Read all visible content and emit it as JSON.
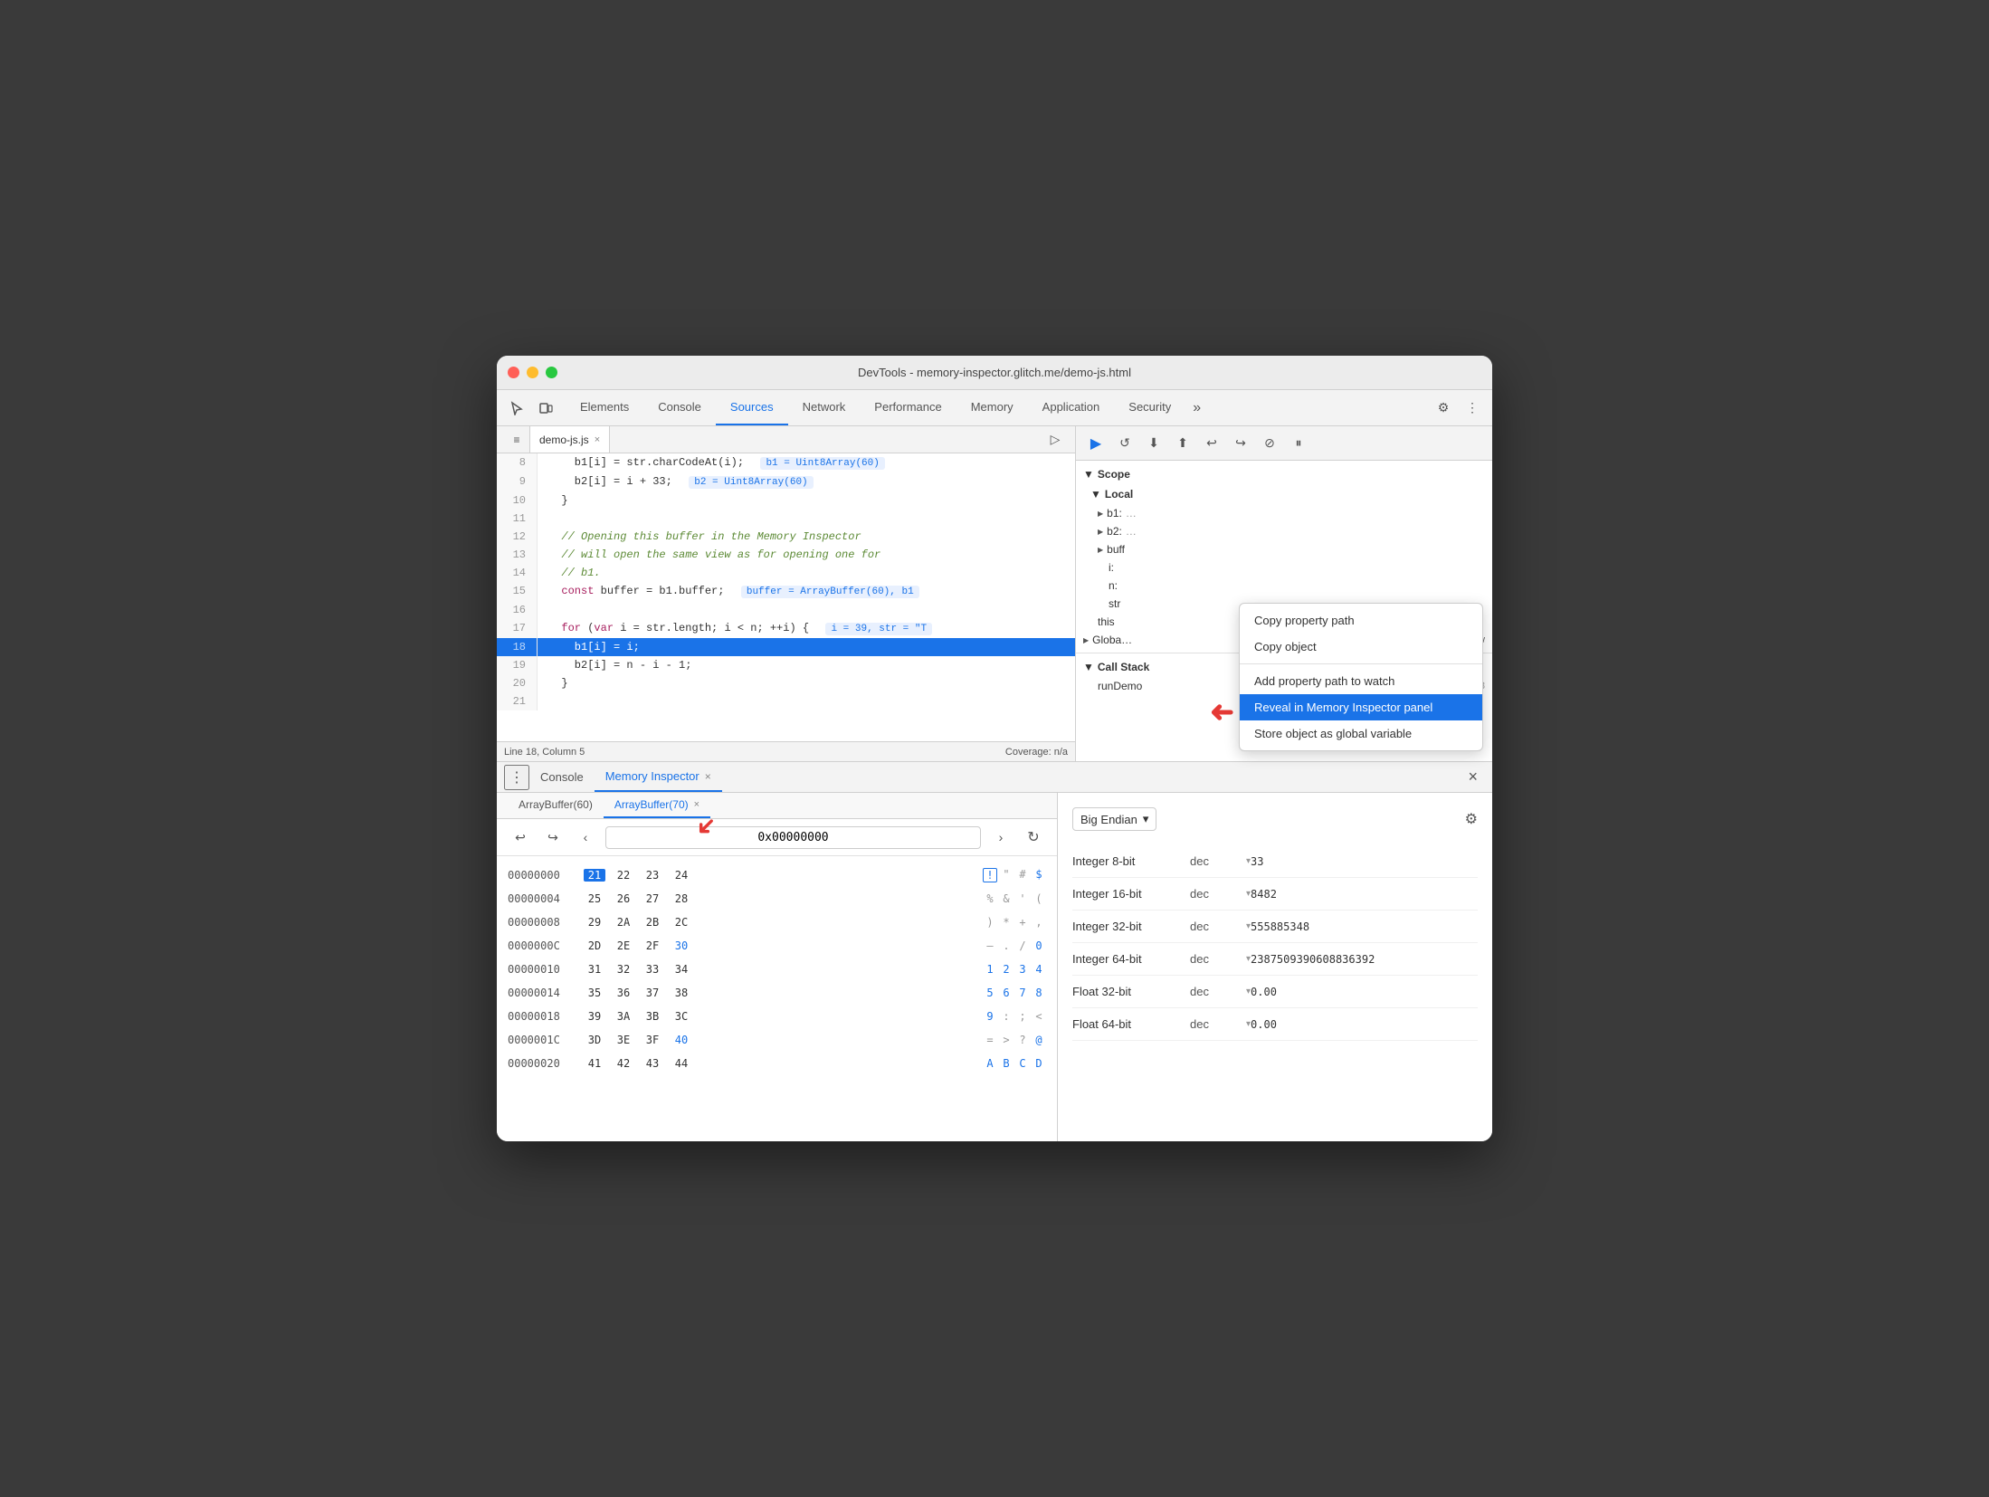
{
  "window": {
    "title": "DevTools - memory-inspector.glitch.me/demo-js.html"
  },
  "nav": {
    "tabs": [
      {
        "label": "Elements",
        "active": false
      },
      {
        "label": "Console",
        "active": false
      },
      {
        "label": "Sources",
        "active": true
      },
      {
        "label": "Network",
        "active": false
      },
      {
        "label": "Performance",
        "active": false
      },
      {
        "label": "Memory",
        "active": false
      },
      {
        "label": "Application",
        "active": false
      },
      {
        "label": "Security",
        "active": false
      }
    ]
  },
  "code_tab": {
    "filename": "demo-js.js",
    "close": "×"
  },
  "code_lines": [
    {
      "num": "8",
      "text": "    b1[i] = str.charCodeAt(i);",
      "inline_val": "b1 = Uint8Array(60)",
      "highlighted": false
    },
    {
      "num": "9",
      "text": "    b2[i] = i + 33;",
      "inline_val": "b2 = Uint8Array(60)",
      "highlighted": false
    },
    {
      "num": "10",
      "text": "  }",
      "highlighted": false
    },
    {
      "num": "11",
      "text": "",
      "highlighted": false
    },
    {
      "num": "12",
      "text": "  // Opening this buffer in the Memory Inspector",
      "highlighted": false,
      "comment": true
    },
    {
      "num": "13",
      "text": "  // will open the same view as for opening one for",
      "highlighted": false,
      "comment": true
    },
    {
      "num": "14",
      "text": "  // b1.",
      "highlighted": false,
      "comment": true
    },
    {
      "num": "15",
      "text": "  const buffer = b1.buffer;",
      "inline_val": "buffer = ArrayBuffer(60), b1",
      "highlighted": false
    },
    {
      "num": "16",
      "text": "",
      "highlighted": false
    },
    {
      "num": "17",
      "text": "  for (var i = str.length; i < n; ++i) {",
      "inline_val": "i = 39, str = \"T",
      "highlighted": false
    },
    {
      "num": "18",
      "text": "    b1[i] = i;",
      "highlighted": true
    },
    {
      "num": "19",
      "text": "    b2[i] = n - i - 1;",
      "highlighted": false
    },
    {
      "num": "20",
      "text": "  }",
      "highlighted": false
    },
    {
      "num": "21",
      "text": "",
      "highlighted": false
    }
  ],
  "status_bar": {
    "position": "Line 18, Column 5",
    "coverage": "Coverage: n/a"
  },
  "scope": {
    "header": "▼ Scope",
    "local_header": "▼ Local",
    "items": [
      {
        "label": "b1:",
        "value": "…"
      },
      {
        "label": "b2:",
        "value": "…"
      },
      {
        "label": "buff",
        "value": ""
      },
      {
        "label": "i:",
        "value": ""
      },
      {
        "label": "n:",
        "value": ""
      },
      {
        "label": "str",
        "value": ""
      }
    ],
    "global_header": "▶ Globa…",
    "global_value": "Window"
  },
  "call_stack": {
    "header": "▼ Call Stack",
    "item": "runDemo",
    "location": "demo-js.js:18"
  },
  "context_menu": {
    "items": [
      {
        "label": "Copy property path",
        "active": false
      },
      {
        "label": "Copy object",
        "active": false
      },
      {
        "separator": true
      },
      {
        "label": "Add property path to watch",
        "active": false
      },
      {
        "label": "Reveal in Memory Inspector panel",
        "active": true
      },
      {
        "label": "Store object as global variable",
        "active": false
      }
    ]
  },
  "bottom_panel": {
    "tabs": [
      {
        "label": "Console",
        "active": false,
        "closeable": false
      },
      {
        "label": "Memory Inspector",
        "active": true,
        "closeable": true
      }
    ],
    "close_label": "×"
  },
  "memory": {
    "buffer_tabs": [
      {
        "label": "ArrayBuffer(60)",
        "active": false
      },
      {
        "label": "ArrayBuffer(70)",
        "active": true,
        "closeable": true
      }
    ],
    "address": "0x00000000",
    "endian": "Big Endian",
    "rows": [
      {
        "addr": "00000000",
        "bytes": [
          "21",
          "22",
          "23",
          "24"
        ],
        "chars": [
          "!",
          "\"",
          "#",
          "$"
        ],
        "selected_byte": 0
      },
      {
        "addr": "00000004",
        "bytes": [
          "25",
          "26",
          "27",
          "28"
        ],
        "chars": [
          "%",
          "&",
          "'",
          "("
        ]
      },
      {
        "addr": "00000008",
        "bytes": [
          "29",
          "2A",
          "2B",
          "2C"
        ],
        "chars": [
          ")",
          "*",
          "+",
          ","
        ]
      },
      {
        "addr": "0000000C",
        "bytes": [
          "2D",
          "2E",
          "2F",
          "30"
        ],
        "chars": [
          "–",
          ".",
          "/",
          "0"
        ]
      },
      {
        "addr": "00000010",
        "bytes": [
          "31",
          "32",
          "33",
          "34"
        ],
        "chars": [
          "1",
          "2",
          "3",
          "4"
        ]
      },
      {
        "addr": "00000014",
        "bytes": [
          "35",
          "36",
          "37",
          "38"
        ],
        "chars": [
          "5",
          "6",
          "7",
          "8"
        ]
      },
      {
        "addr": "00000018",
        "bytes": [
          "39",
          "3A",
          "3B",
          "3C"
        ],
        "chars": [
          "9",
          ":",
          ";",
          "<"
        ]
      },
      {
        "addr": "0000001C",
        "bytes": [
          "3D",
          "3E",
          "3F",
          "40"
        ],
        "chars": [
          "=",
          ">",
          "?",
          "@"
        ]
      },
      {
        "addr": "00000020",
        "bytes": [
          "41",
          "42",
          "43",
          "44"
        ],
        "chars": [
          "A",
          "B",
          "C",
          "D"
        ]
      }
    ],
    "data_types": [
      {
        "label": "Integer 8-bit",
        "format": "dec",
        "value": "33"
      },
      {
        "label": "Integer 16-bit",
        "format": "dec",
        "value": "8482"
      },
      {
        "label": "Integer 32-bit",
        "format": "dec",
        "value": "555885348"
      },
      {
        "label": "Integer 64-bit",
        "format": "dec",
        "value": "2387509390608836392"
      },
      {
        "label": "Float 32-bit",
        "format": "dec",
        "value": "0.00"
      },
      {
        "label": "Float 64-bit",
        "format": "dec",
        "value": "0.00"
      }
    ]
  }
}
